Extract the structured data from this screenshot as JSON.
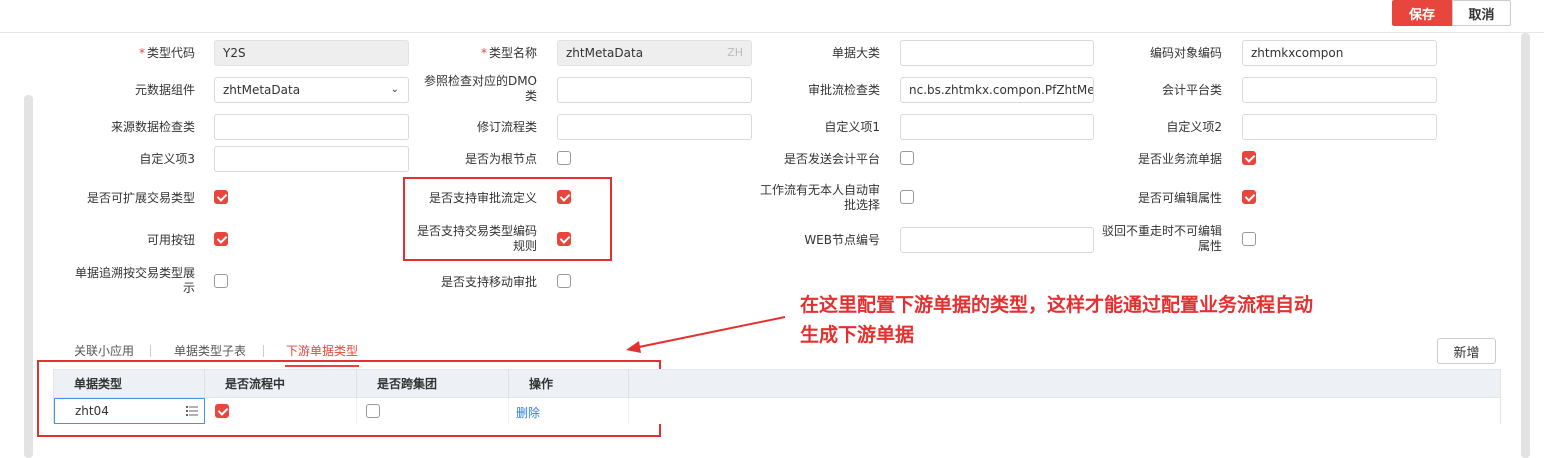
{
  "toolbar": {
    "save_label": "保存",
    "cancel_label": "取消"
  },
  "form": {
    "type_code": {
      "label": "类型代码",
      "value": "Y2S"
    },
    "type_name": {
      "label": "类型名称",
      "value": "zhtMetaData",
      "suffix": "ZH"
    },
    "bill_category": {
      "label": "单据大类",
      "value": ""
    },
    "code_object_code": {
      "label": "编码对象编码",
      "value": "zhtmkxcompon"
    },
    "metadata_component": {
      "label": "元数据组件",
      "value": "zhtMetaData"
    },
    "ref_check_dmo": {
      "label_line1": "参照检查对应的DMO",
      "label_line2": "类",
      "value": ""
    },
    "approval_check_class": {
      "label": "审批流检查类",
      "value": "nc.bs.zhtmkx.compon.PfZhtMetal"
    },
    "accounting_platform_class": {
      "label": "会计平台类",
      "value": ""
    },
    "source_data_check": {
      "label": "来源数据检查类",
      "value": ""
    },
    "revision_flow_class": {
      "label": "修订流程类",
      "value": ""
    },
    "custom1": {
      "label": "自定义项1",
      "value": ""
    },
    "custom2": {
      "label": "自定义项2",
      "value": ""
    },
    "custom3": {
      "label": "自定义项3",
      "value": ""
    },
    "is_root_node": {
      "label": "是否为根节点",
      "checked": false
    },
    "send_accounting": {
      "label": "是否发送会计平台",
      "checked": false
    },
    "is_business_flow_bill": {
      "label": "是否业务流单据",
      "checked": true
    },
    "extendable_tx_type": {
      "label": "是否可扩展交易类型",
      "checked": true
    },
    "support_approval_def": {
      "label": "是否支持审批流定义",
      "checked": true
    },
    "workflow_auto_select": {
      "label_line1": "工作流有无本人自动审",
      "label_line2": "批选择",
      "checked": false
    },
    "editable_attrs": {
      "label": "是否可编辑属性",
      "checked": true
    },
    "available_buttons": {
      "label": "可用按钮",
      "checked": true
    },
    "support_tx_code_rule": {
      "label_line1": "是否支持交易类型编码",
      "label_line2": "规则",
      "checked": true
    },
    "web_node_code": {
      "label": "WEB节点编号",
      "value": ""
    },
    "reject_noneditable": {
      "label_line1": "驳回不重走时不可编辑",
      "label_line2": "属性",
      "checked": false
    },
    "trace_by_tx_type": {
      "label_line1": "单据追溯按交易类型展",
      "label_line2": "示",
      "checked": false
    },
    "support_mobile_approval": {
      "label": "是否支持移动审批",
      "checked": false
    }
  },
  "annotation": {
    "line1": "在这里配置下游单据的类型，这样才能通过配置业务流程自动",
    "line2": "生成下游单据"
  },
  "tabs": [
    {
      "label": "关联小应用",
      "active": false
    },
    {
      "label": "单据类型子表",
      "active": false
    },
    {
      "label": "下游单据类型",
      "active": true
    }
  ],
  "new_button_label": "新增",
  "grid": {
    "columns": [
      "单据类型",
      "是否流程中",
      "是否跨集团",
      "操作"
    ],
    "rows": [
      {
        "bill_type": "zht04",
        "in_flow": true,
        "cross_group": false,
        "action": "删除"
      }
    ]
  },
  "colors": {
    "accent": "#e8453c",
    "annotation_red": "#e53030",
    "link": "#2d7be5"
  }
}
